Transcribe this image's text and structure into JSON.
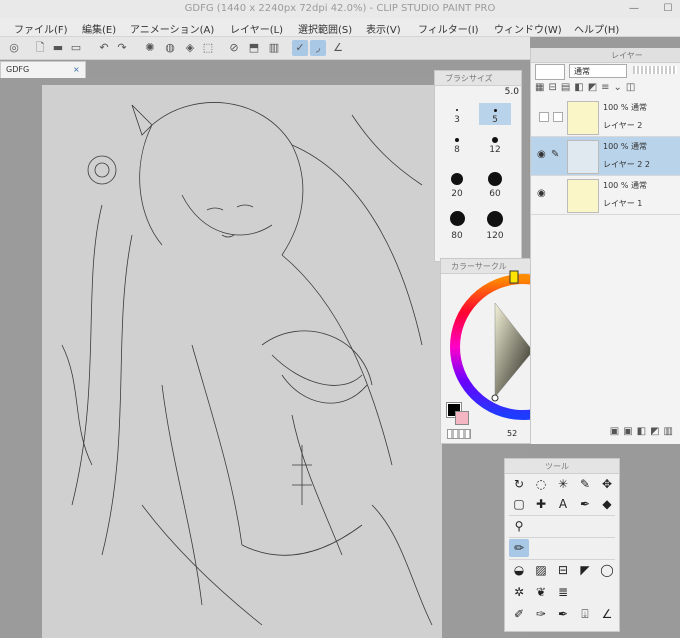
{
  "window": {
    "title": "GDFG (1440 x 2240px 72dpi 42.0%) - CLIP STUDIO PAINT PRO"
  },
  "menu": [
    {
      "label": "ファイル(F)"
    },
    {
      "label": "編集(E)"
    },
    {
      "label": "アニメーション(A)"
    },
    {
      "label": "レイヤー(L)"
    },
    {
      "label": "選択範囲(S)"
    },
    {
      "label": "表示(V)"
    },
    {
      "label": "フィルター(I)"
    },
    {
      "label": "ウィンドウ(W)"
    },
    {
      "label": "ヘルプ(H)"
    }
  ],
  "document_tab": {
    "name": "GDFG",
    "close": "×"
  },
  "brush_size_palette": {
    "title": "ブラシサイズ",
    "current_value": "5.0",
    "sizes": [
      "3",
      "5",
      "8",
      "12",
      "20",
      "60",
      "80",
      "120"
    ]
  },
  "color_palette": {
    "title": "カラーサークル",
    "value_label": "52"
  },
  "layer_panel": {
    "title": "レイヤー",
    "blend_mode": "通常",
    "layers": [
      {
        "mode": "100 % 通常",
        "name": "レイヤー 2",
        "selected": false
      },
      {
        "mode": "100 % 通常",
        "name": "レイヤー 2 2",
        "selected": true
      },
      {
        "mode": "100 % 通常",
        "name": "レイヤー 1",
        "selected": false
      }
    ]
  },
  "tool_palette": {
    "title": "ツール",
    "tools": [
      {
        "name": "zoom-tool",
        "glyph": "↻"
      },
      {
        "name": "lasso-tool",
        "glyph": "◌"
      },
      {
        "name": "auto-select-tool",
        "glyph": "✳"
      },
      {
        "name": "pen-tool",
        "glyph": "✎"
      },
      {
        "name": "move-tool",
        "glyph": "✥"
      },
      {
        "name": "selection-tool",
        "glyph": "▢"
      },
      {
        "name": "eyedropper-tool",
        "glyph": "✚"
      },
      {
        "name": "text-tool",
        "glyph": "A"
      },
      {
        "name": "brush-tool",
        "glyph": "✒"
      },
      {
        "name": "eraser-tool",
        "glyph": "◆"
      }
    ]
  },
  "colors": {
    "main_color": "#000000",
    "sub_color": "#f4b6c2",
    "accent": "#a9c8e6"
  }
}
